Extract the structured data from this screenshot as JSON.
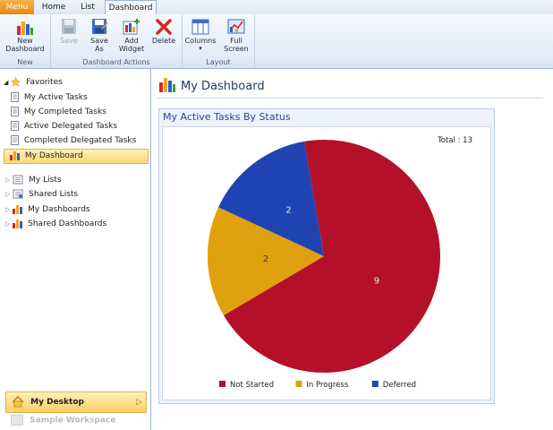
{
  "tabs": {
    "menu": "Menu",
    "home": "Home",
    "list": "List",
    "dashboard": "Dashboard"
  },
  "ribbon": {
    "new_dashboard": "New\nDashboard",
    "new_group": "New",
    "save": "Save",
    "save_as": "Save\nAs",
    "add_widget": "Add\nWidget",
    "delete": "Delete",
    "actions_group": "Dashboard Actions",
    "columns": "Columns",
    "full_screen": "Full\nScreen",
    "layout_group": "Layout"
  },
  "sidebar": {
    "favorites": "Favorites",
    "items": [
      {
        "label": "My Active Tasks"
      },
      {
        "label": "My Completed Tasks"
      },
      {
        "label": "Active Delegated Tasks"
      },
      {
        "label": "Completed Delegated Tasks"
      },
      {
        "label": "My Dashboard"
      }
    ],
    "groups": [
      {
        "label": "My Lists"
      },
      {
        "label": "Shared Lists"
      },
      {
        "label": "My Dashboards"
      },
      {
        "label": "Shared Dashboards"
      }
    ],
    "my_desktop": "My Desktop",
    "sample_workspace": "Sample Workspace"
  },
  "main": {
    "title": "My Dashboard",
    "widget_title": "My Active Tasks By Status"
  },
  "chart_data": {
    "type": "pie",
    "title": "My Active Tasks By Status",
    "total_label": "Total : 13",
    "categories": [
      "Not Started",
      "In Progress",
      "Deferred"
    ],
    "values": [
      9,
      2,
      2
    ],
    "colors": [
      "#b5102a",
      "#e0a10e",
      "#1f44b2"
    ],
    "legend": "bottom"
  }
}
